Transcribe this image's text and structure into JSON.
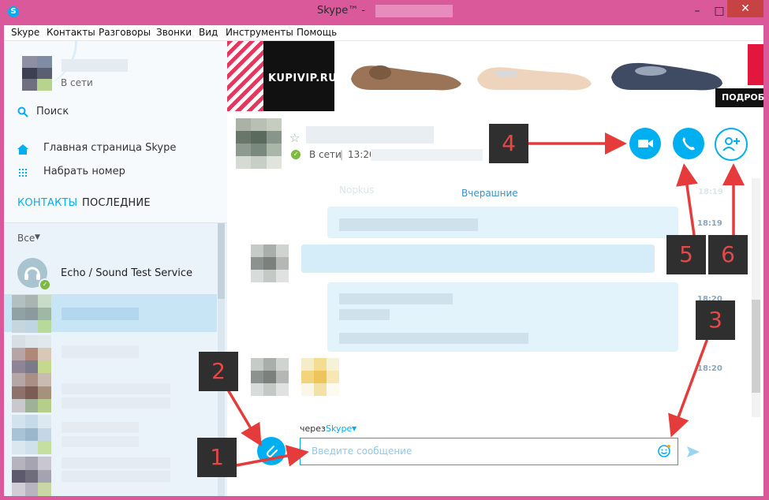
{
  "window": {
    "title": "Skype™ -"
  },
  "menu": [
    "Skype",
    "Контакты",
    "Разговоры",
    "Звонки",
    "Вид",
    "Инструменты",
    "Помощь"
  ],
  "profile": {
    "status": "В сети"
  },
  "sidebar": {
    "search_label": "Поиск",
    "home_label": "Главная страница Skype",
    "dial_label": "Набрать номер",
    "tab_contacts": "КОНТАКТЫ",
    "tab_recent": "ПОСЛЕДНИЕ",
    "filter_label": "Все",
    "contacts": [
      {
        "name": "Echo / Sound Test Service"
      }
    ]
  },
  "ad": {
    "brand": "KUPIVIP.RU",
    "cta": "ПОДРОБ"
  },
  "conversation": {
    "status": "В сети",
    "separator": "|",
    "time": "13:20"
  },
  "messages": {
    "day_label": "Вчерашние",
    "faded_top": "Nopkus",
    "times": [
      "18:19",
      "18:20",
      "18:20"
    ],
    "faded_time": "18:19"
  },
  "composer": {
    "via_label": "через",
    "via_service": "Skype",
    "placeholder": "Введите сообщение"
  },
  "markers": [
    "1",
    "2",
    "3",
    "4",
    "5",
    "6"
  ],
  "colors": {
    "accent": "#00aff0",
    "online": "#7cba40",
    "marker_bg": "#2f2f2f",
    "marker_text": "#e54848",
    "arrow": "#e53b3b"
  },
  "icons": [
    "skype-logo-icon",
    "search-icon",
    "home-icon",
    "dialpad-icon",
    "headset-icon",
    "star-icon",
    "video-call-icon",
    "phone-icon",
    "add-contact-icon",
    "attach-icon",
    "emoji-icon",
    "send-icon"
  ]
}
